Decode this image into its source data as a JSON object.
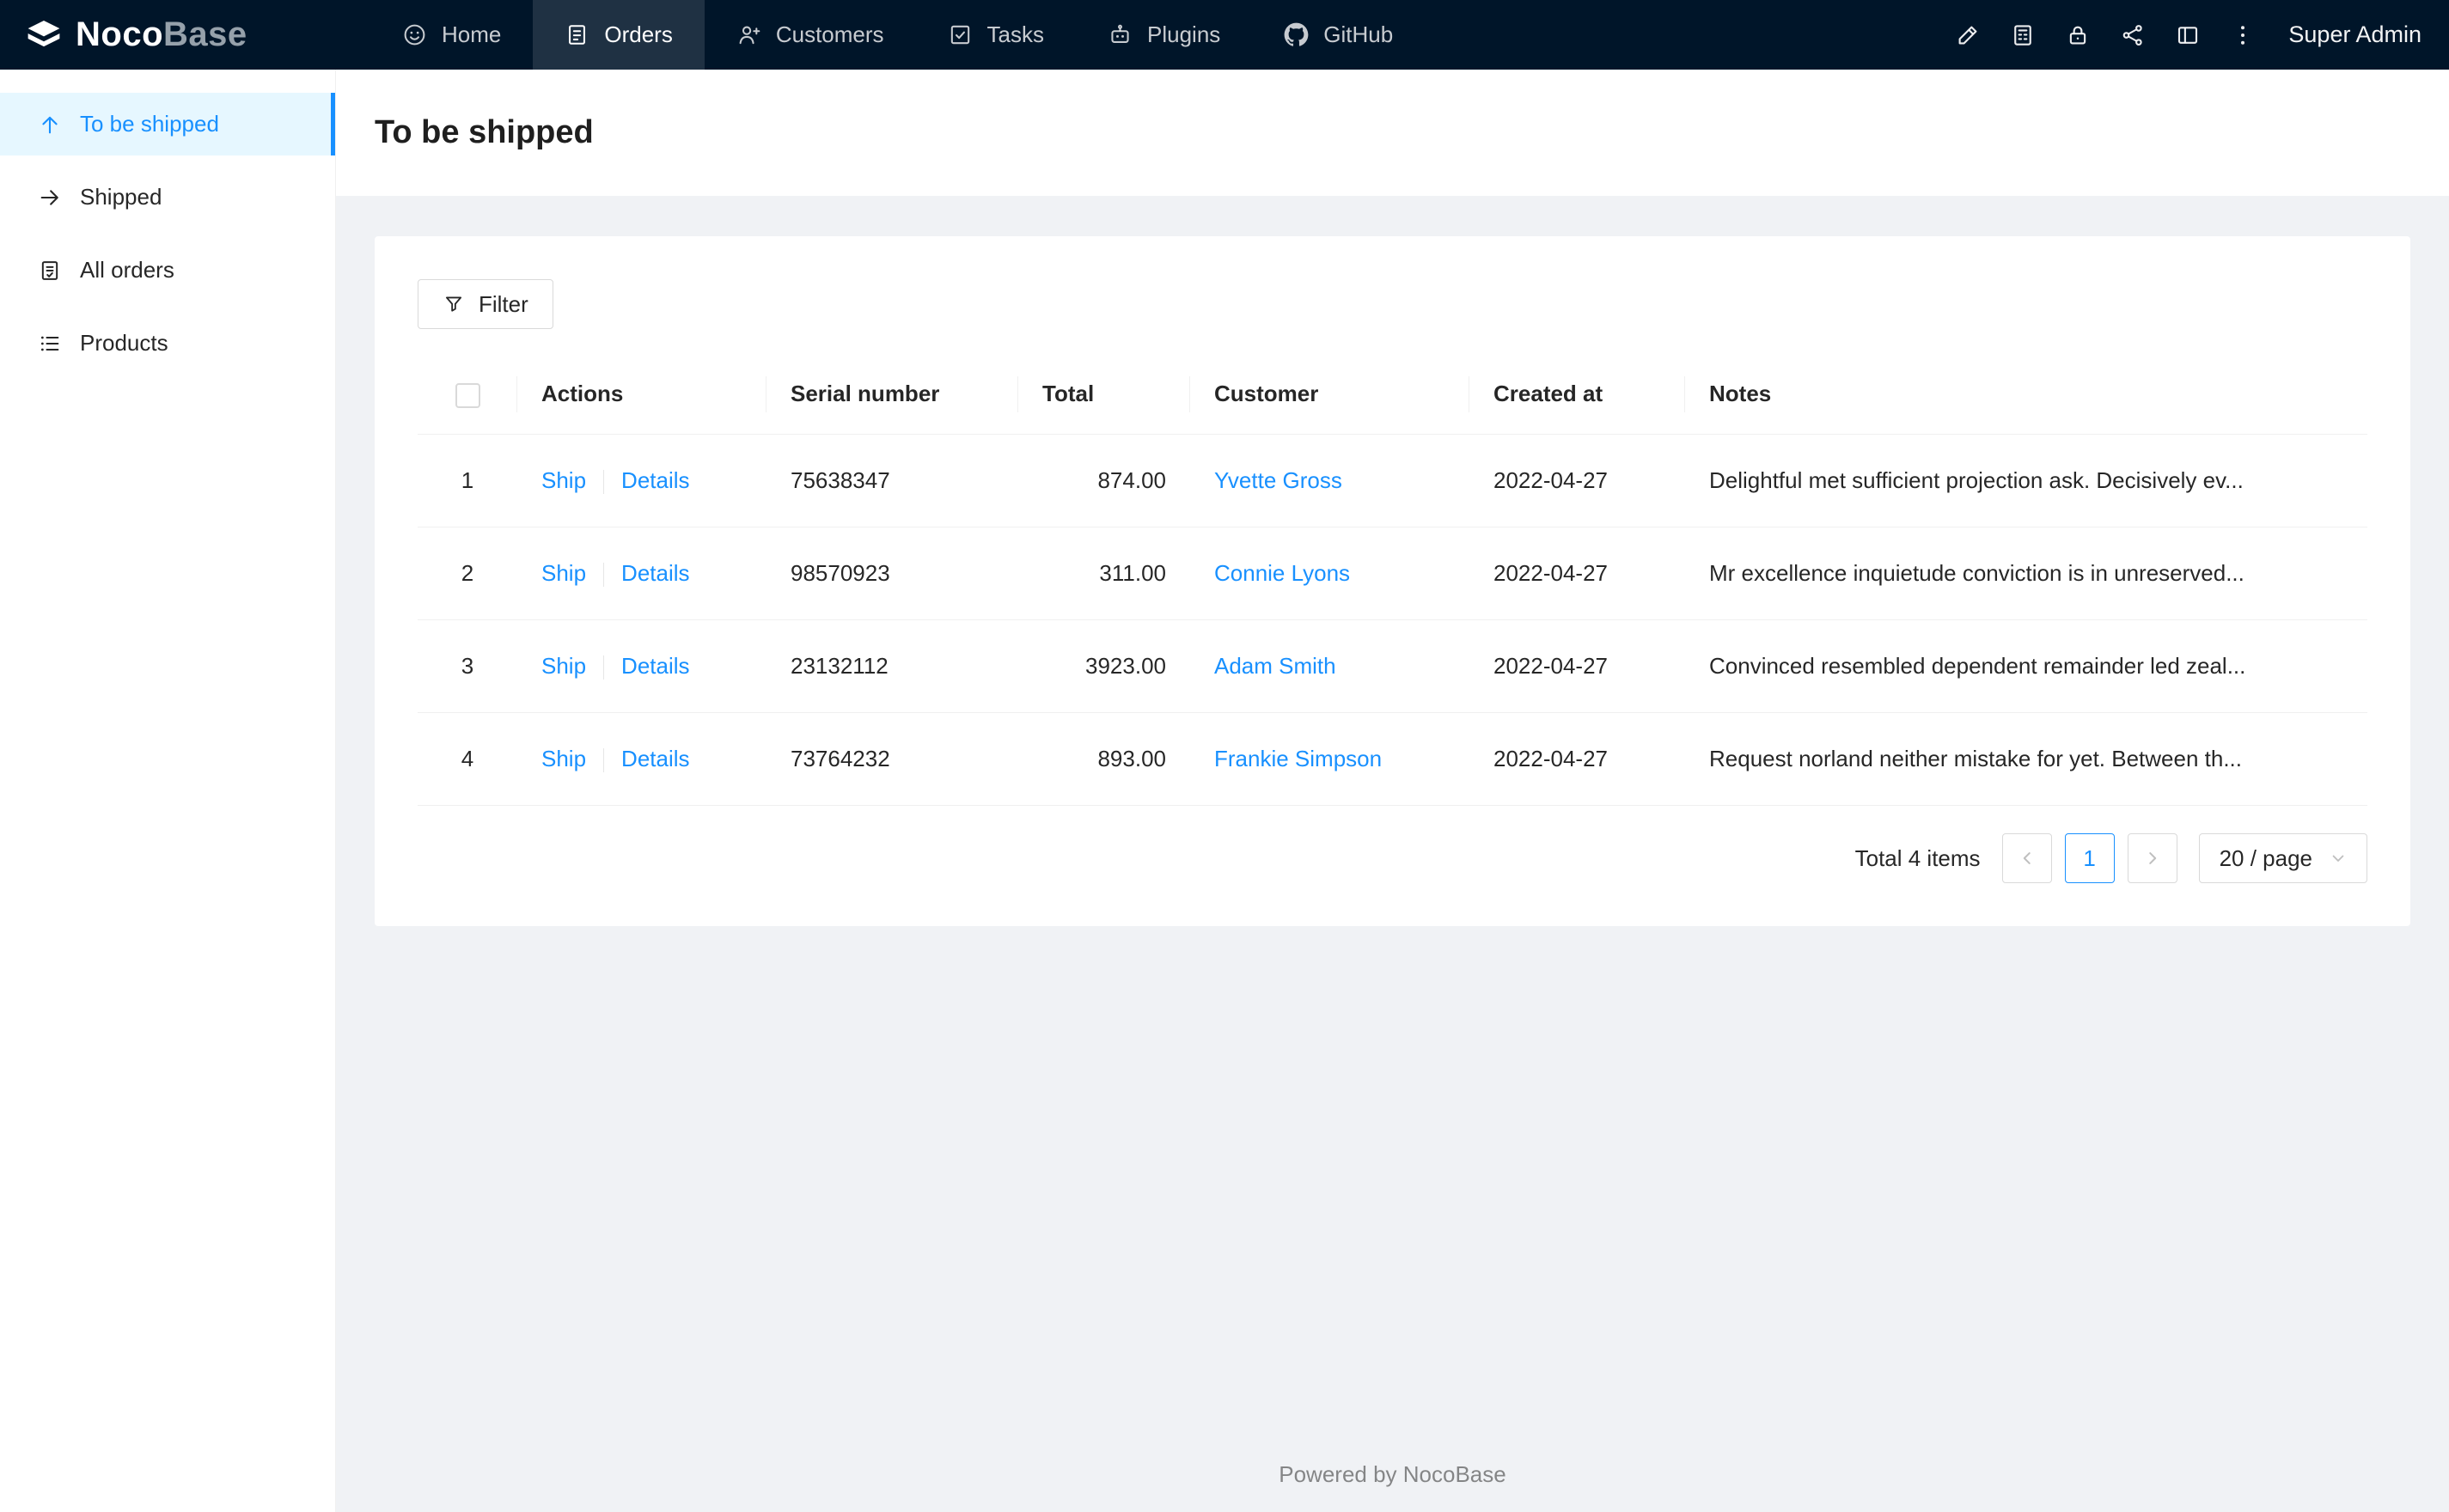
{
  "navbar": {
    "logo": {
      "part1": "Noco",
      "part2": "Base"
    },
    "items": [
      {
        "label": "Home",
        "icon": "smile-icon",
        "active": false
      },
      {
        "label": "Orders",
        "icon": "orders-icon",
        "active": true
      },
      {
        "label": "Customers",
        "icon": "customer-icon",
        "active": false
      },
      {
        "label": "Tasks",
        "icon": "check-square-icon",
        "active": false
      },
      {
        "label": "Plugins",
        "icon": "robot-icon",
        "active": false
      },
      {
        "label": "GitHub",
        "icon": "github-icon",
        "active": false
      }
    ],
    "right_icons": [
      "highlighter-icon",
      "calculator-icon",
      "lock-icon",
      "share-icon",
      "layout-icon",
      "more-icon"
    ],
    "user": "Super Admin"
  },
  "sidebar": {
    "items": [
      {
        "label": "To be shipped",
        "icon": "arrow-up-icon",
        "active": true
      },
      {
        "label": "Shipped",
        "icon": "arrow-right-icon",
        "active": false
      },
      {
        "label": "All orders",
        "icon": "file-done-icon",
        "active": false
      },
      {
        "label": "Products",
        "icon": "list-icon",
        "active": false
      }
    ]
  },
  "page": {
    "title": "To be shipped"
  },
  "toolbar": {
    "filter_label": "Filter"
  },
  "table": {
    "columns": [
      "Actions",
      "Serial number",
      "Total",
      "Customer",
      "Created at",
      "Notes"
    ],
    "rows": [
      {
        "index": "1",
        "ship": "Ship",
        "details": "Details",
        "serial": "75638347",
        "total": "874.00",
        "customer": "Yvette Gross",
        "created_at": "2022-04-27",
        "notes": "Delightful met sufficient projection ask. Decisively ev..."
      },
      {
        "index": "2",
        "ship": "Ship",
        "details": "Details",
        "serial": "98570923",
        "total": "311.00",
        "customer": "Connie Lyons",
        "created_at": "2022-04-27",
        "notes": "Mr excellence inquietude conviction is in unreserved..."
      },
      {
        "index": "3",
        "ship": "Ship",
        "details": "Details",
        "serial": "23132112",
        "total": "3923.00",
        "customer": "Adam Smith",
        "created_at": "2022-04-27",
        "notes": "Convinced resembled dependent remainder led zeal..."
      },
      {
        "index": "4",
        "ship": "Ship",
        "details": "Details",
        "serial": "73764232",
        "total": "893.00",
        "customer": "Frankie Simpson",
        "created_at": "2022-04-27",
        "notes": "Request norland neither mistake for yet. Between th..."
      }
    ]
  },
  "pagination": {
    "total_label": "Total 4 items",
    "current": "1",
    "page_size": "20 / page"
  },
  "footer": {
    "text": "Powered by NocoBase"
  },
  "colors": {
    "accent": "#1890ff",
    "navbar_bg": "#001529",
    "sidebar_active_bg": "#e6f7ff",
    "content_bg": "#f0f2f5",
    "border": "#f0f0f0"
  }
}
